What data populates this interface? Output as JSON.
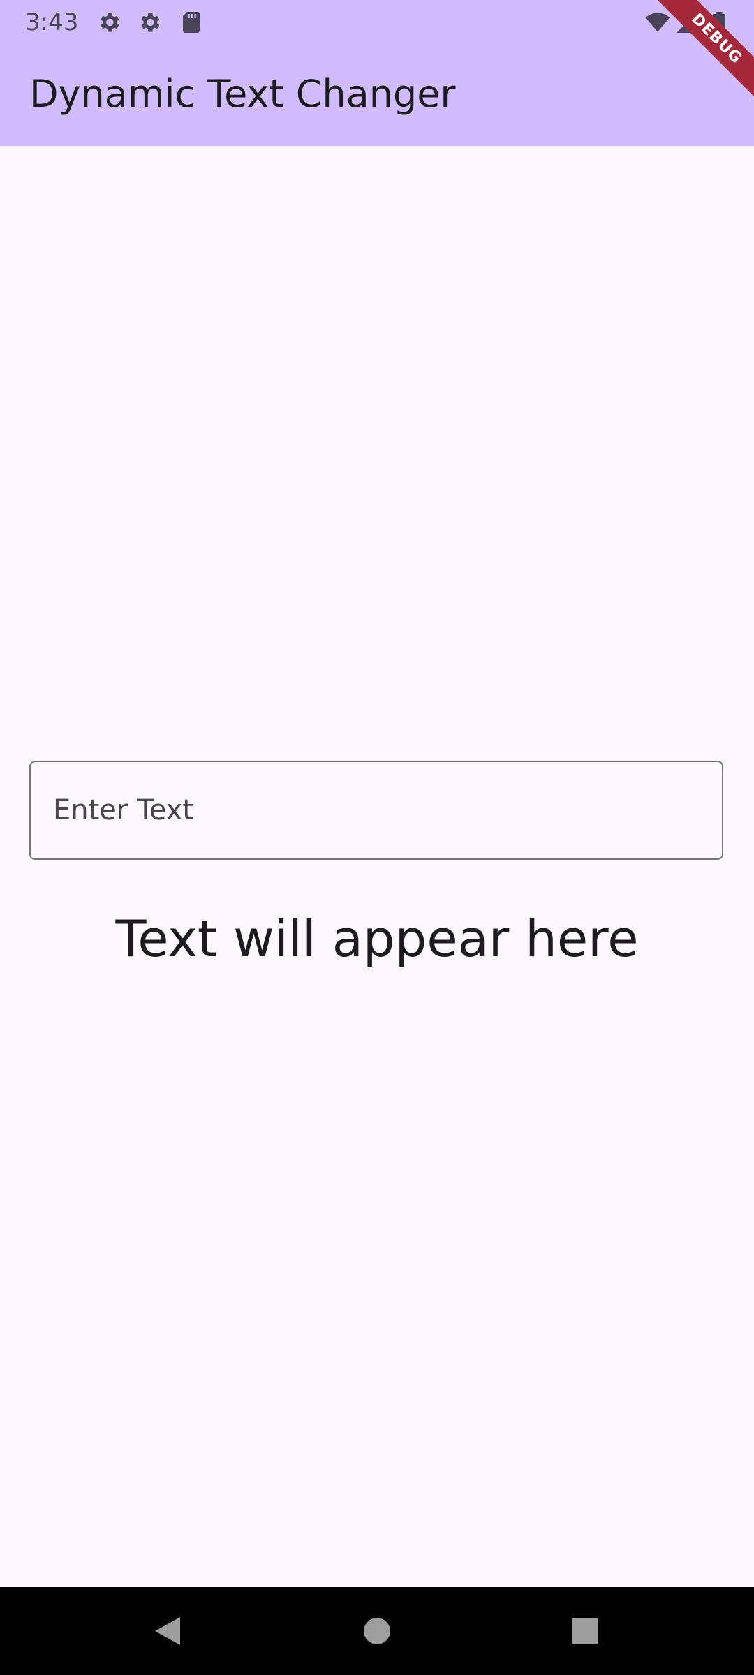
{
  "status_bar": {
    "time": "3:43",
    "icons": [
      "gear-icon",
      "gear-icon",
      "sd-card-icon",
      "wifi-icon",
      "signal-icon",
      "battery-icon"
    ]
  },
  "app_bar": {
    "title": "Dynamic Text Changer"
  },
  "debug_banner": {
    "label": "DEBUG"
  },
  "input": {
    "placeholder": "Enter Text",
    "value": ""
  },
  "output": {
    "text": "Text will appear here"
  },
  "nav_bar": {
    "buttons": [
      "back-icon",
      "home-icon",
      "recents-icon"
    ]
  },
  "colors": {
    "app_bar": "#d0bcff",
    "background": "#fdf7ff",
    "debug_ribbon": "#a5283b",
    "outline": "#79747e"
  }
}
